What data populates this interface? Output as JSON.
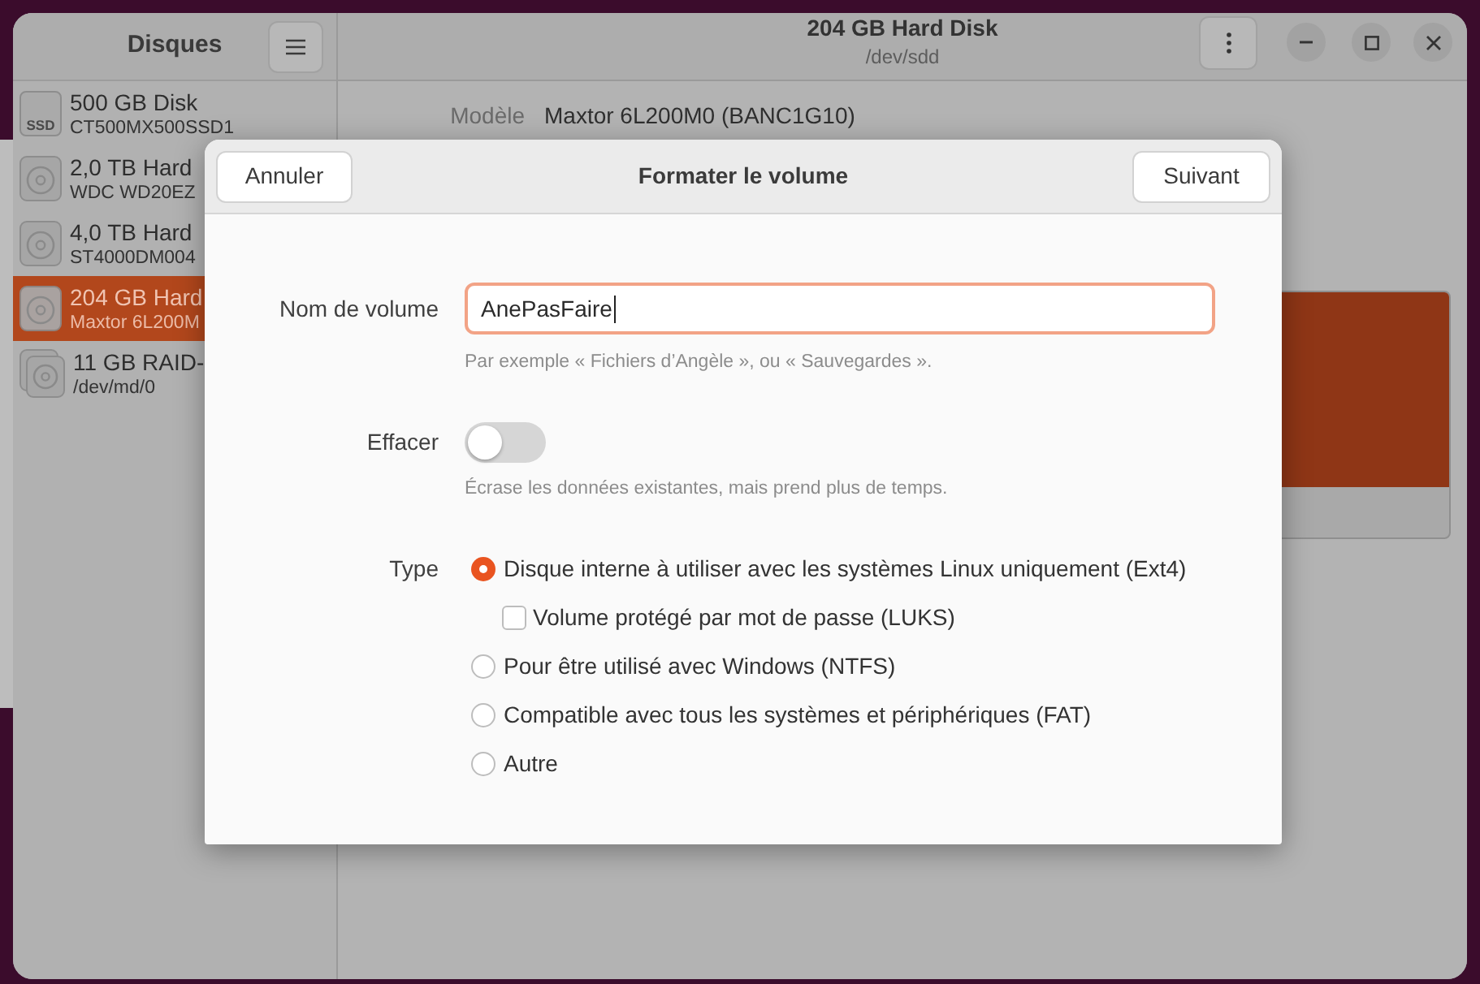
{
  "sidebar": {
    "title": "Disques",
    "items": [
      {
        "kind": "ssd",
        "icon_label": "SSD",
        "name": "500 GB Disk",
        "detail": "CT500MX500SSD1",
        "selected": false
      },
      {
        "kind": "hdd",
        "name": "2,0 TB Hard",
        "detail": "WDC WD20EZ",
        "selected": false
      },
      {
        "kind": "hdd",
        "name": "4,0 TB Hard",
        "detail": "ST4000DM004",
        "selected": false
      },
      {
        "kind": "hdd",
        "name": "204 GB Hard",
        "detail": "Maxtor 6L200M",
        "selected": true
      },
      {
        "kind": "raid",
        "name": "11 GB RAID-",
        "detail": "/dev/md/0",
        "selected": false
      }
    ]
  },
  "header": {
    "title": "204 GB Hard Disk",
    "subtitle": "/dev/sdd"
  },
  "details": [
    {
      "label": "Modèle",
      "value": "Maxtor 6L200M0 (BANC1G10)"
    }
  ],
  "dialog": {
    "title": "Formater le volume",
    "cancel_button": "Annuler",
    "next_button": "Suivant",
    "volume_name": {
      "label": "Nom de volume",
      "value": "AnePasFaire",
      "focused": true,
      "hint": "Par exemple « Fichiers d’Angèle », ou « Sauvegardes »."
    },
    "erase": {
      "label": "Effacer",
      "on": false,
      "hint": "Écrase les données existantes, mais prend plus de temps."
    },
    "type": {
      "label": "Type",
      "options": [
        {
          "label": "Disque interne à utiliser avec les systèmes Linux uniquement (Ext4)",
          "selected": true,
          "suboption": {
            "label": "Volume protégé par mot de passe (LUKS)",
            "checked": false
          }
        },
        {
          "label": "Pour être utilisé avec Windows (NTFS)",
          "selected": false
        },
        {
          "label": "Compatible avec tous les systèmes et périphériques (FAT)",
          "selected": false
        },
        {
          "label": "Autre",
          "selected": false
        }
      ]
    }
  }
}
